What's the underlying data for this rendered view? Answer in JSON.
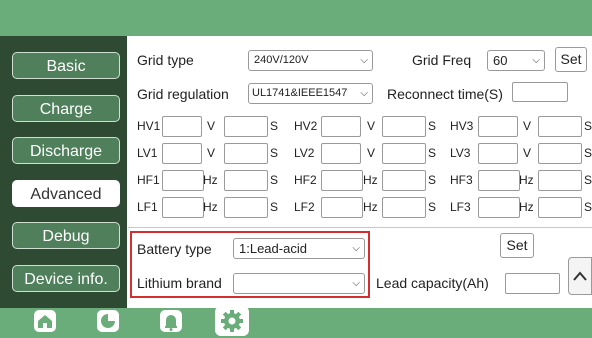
{
  "sidebar": {
    "items": [
      {
        "label": "Basic",
        "active": false
      },
      {
        "label": "Charge",
        "active": false
      },
      {
        "label": "Discharge",
        "active": false
      },
      {
        "label": "Advanced",
        "active": true
      },
      {
        "label": "Debug",
        "active": false
      },
      {
        "label": "Device info.",
        "active": false
      }
    ]
  },
  "grid": {
    "type_label": "Grid type",
    "type_value": "240V/120V",
    "freq_label": "Grid Freq",
    "freq_value": "60",
    "set_label": "Set",
    "regulation_label": "Grid regulation",
    "regulation_value": "UL1741&IEEE1547",
    "reconnect_label": "Reconnect time(S)",
    "reconnect_value": ""
  },
  "protection_rows": [
    {
      "cells": [
        {
          "name": "HV1",
          "unit1": "V",
          "unit2": "S"
        },
        {
          "name": "HV2",
          "unit1": "V",
          "unit2": "S"
        },
        {
          "name": "HV3",
          "unit1": "V",
          "unit2": "S"
        }
      ]
    },
    {
      "cells": [
        {
          "name": "LV1",
          "unit1": "V",
          "unit2": "S"
        },
        {
          "name": "LV2",
          "unit1": "V",
          "unit2": "S"
        },
        {
          "name": "LV3",
          "unit1": "V",
          "unit2": "S"
        }
      ]
    },
    {
      "cells": [
        {
          "name": "HF1",
          "unit1": "Hz",
          "unit2": "S"
        },
        {
          "name": "HF2",
          "unit1": "Hz",
          "unit2": "S"
        },
        {
          "name": "HF3",
          "unit1": "Hz",
          "unit2": "S"
        }
      ]
    },
    {
      "cells": [
        {
          "name": "LF1",
          "unit1": "Hz",
          "unit2": "S"
        },
        {
          "name": "LF2",
          "unit1": "Hz",
          "unit2": "S"
        },
        {
          "name": "LF3",
          "unit1": "Hz",
          "unit2": "S"
        }
      ]
    }
  ],
  "battery": {
    "type_label": "Battery type",
    "type_value": "1:Lead-acid",
    "brand_label": "Lithium brand",
    "brand_value": "",
    "set_label": "Set",
    "lead_capacity_label": "Lead capacity(Ah)",
    "lead_capacity_value": ""
  },
  "icons": {
    "chevron": "⌵",
    "scroll_up": "^",
    "tabs": [
      "home-icon",
      "pie-chart-icon",
      "bell-icon",
      "gear-icon"
    ]
  },
  "colors": {
    "bar_green": "#6aad7a",
    "sidebar_dark": "#2f4a33",
    "nav_button": "#4f7f5b",
    "highlight_red": "#d32f2f"
  }
}
